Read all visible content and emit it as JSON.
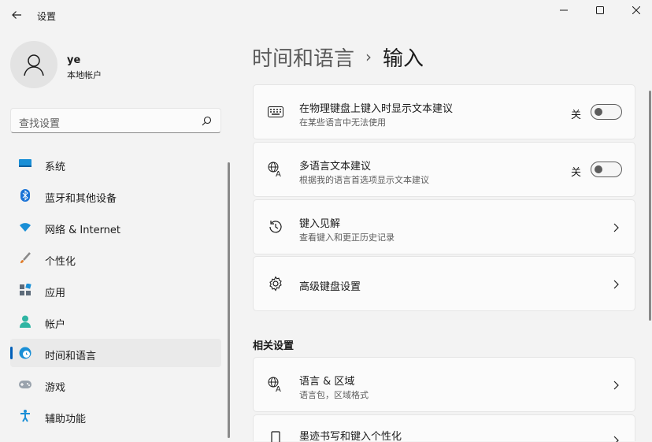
{
  "window": {
    "title": "设置"
  },
  "profile": {
    "name": "ye",
    "account_type": "本地帐户"
  },
  "search": {
    "placeholder": "查找设置"
  },
  "nav": {
    "items": [
      {
        "label": "系统",
        "icon": "system-icon"
      },
      {
        "label": "蓝牙和其他设备",
        "icon": "bluetooth-icon"
      },
      {
        "label": "网络 & Internet",
        "icon": "wifi-icon"
      },
      {
        "label": "个性化",
        "icon": "brush-icon"
      },
      {
        "label": "应用",
        "icon": "apps-icon"
      },
      {
        "label": "帐户",
        "icon": "account-icon"
      },
      {
        "label": "时间和语言",
        "icon": "time-language-icon",
        "active": true
      },
      {
        "label": "游戏",
        "icon": "gamepad-icon"
      },
      {
        "label": "辅助功能",
        "icon": "accessibility-icon"
      }
    ]
  },
  "breadcrumb": {
    "parent": "时间和语言",
    "separator": "›",
    "current": "输入"
  },
  "cards": [
    {
      "title": "在物理键盘上键入时显示文本建议",
      "subtitle": "在某些语言中无法使用",
      "toggle_label": "关",
      "icon": "keyboard-icon"
    },
    {
      "title": "多语言文本建议",
      "subtitle": "根据我的语言首选项显示文本建议",
      "toggle_label": "关",
      "icon": "language-icon"
    },
    {
      "title": "键入见解",
      "subtitle": "查看键入和更正历史记录",
      "icon": "history-icon"
    },
    {
      "title": "高级键盘设置",
      "icon": "gear-icon"
    }
  ],
  "related": {
    "title": "相关设置",
    "cards": [
      {
        "title": "语言 & 区域",
        "subtitle": "语言包，区域格式",
        "icon": "language-icon"
      },
      {
        "title": "墨迹书写和键入个性化",
        "icon": "pen-icon"
      }
    ]
  },
  "colors": {
    "accent": "#005fb8",
    "background": "#f3f3f3",
    "card": "#fbfbfb"
  }
}
